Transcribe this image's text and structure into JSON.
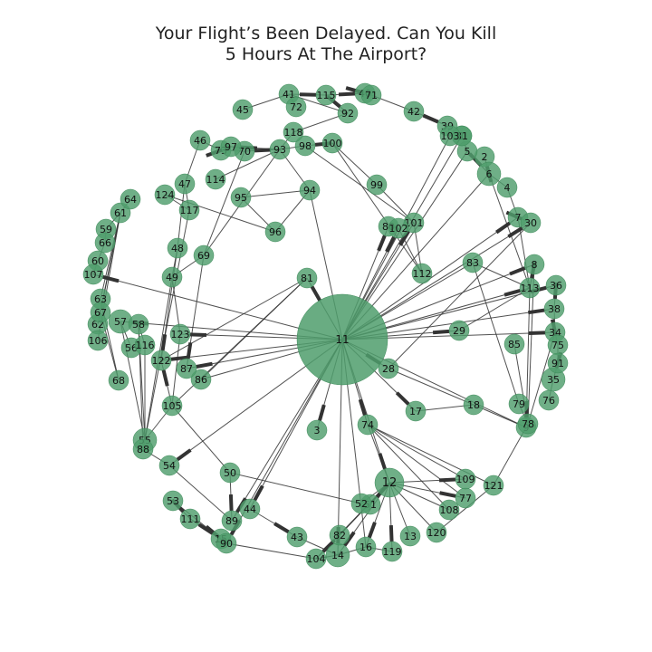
{
  "title": {
    "line1": "Your Flight’s Been Delayed. Can You Kill",
    "line2": "5 Hours At The Airport?"
  },
  "colors": {
    "node_fill": "#4f9d6c",
    "node_stroke": "#3c8a58",
    "edge": "#333333",
    "label": "#111111"
  },
  "nodes": [
    {
      "id": "11",
      "size": "xl"
    },
    {
      "id": "1",
      "size": "m"
    },
    {
      "id": "2",
      "size": "m"
    },
    {
      "id": "3",
      "size": "m"
    },
    {
      "id": "4",
      "size": "m"
    },
    {
      "id": "5",
      "size": "m"
    },
    {
      "id": "6",
      "size": "l"
    },
    {
      "id": "7",
      "size": "m"
    },
    {
      "id": "8",
      "size": "m"
    },
    {
      "id": "9",
      "size": "m"
    },
    {
      "id": "12",
      "size": "xl2"
    },
    {
      "id": "13",
      "size": "m"
    },
    {
      "id": "14",
      "size": "l"
    },
    {
      "id": "15",
      "size": "m"
    },
    {
      "id": "16",
      "size": "m"
    },
    {
      "id": "17",
      "size": "m"
    },
    {
      "id": "18",
      "size": "m"
    },
    {
      "id": "28",
      "size": "m"
    },
    {
      "id": "29",
      "size": "m"
    },
    {
      "id": "30",
      "size": "m"
    },
    {
      "id": "31",
      "size": "m"
    },
    {
      "id": "34",
      "size": "m"
    },
    {
      "id": "35",
      "size": "l"
    },
    {
      "id": "36",
      "size": "m"
    },
    {
      "id": "38",
      "size": "m"
    },
    {
      "id": "39",
      "size": "m"
    },
    {
      "id": "40",
      "size": "m"
    },
    {
      "id": "41",
      "size": "m"
    },
    {
      "id": "42",
      "size": "m"
    },
    {
      "id": "43",
      "size": "m"
    },
    {
      "id": "44",
      "size": "m"
    },
    {
      "id": "45",
      "size": "m"
    },
    {
      "id": "46",
      "size": "m"
    },
    {
      "id": "47",
      "size": "m"
    },
    {
      "id": "48",
      "size": "m"
    },
    {
      "id": "49",
      "size": "m"
    },
    {
      "id": "50",
      "size": "m"
    },
    {
      "id": "51",
      "size": "m"
    },
    {
      "id": "52",
      "size": "m"
    },
    {
      "id": "53",
      "size": "m"
    },
    {
      "id": "54",
      "size": "m"
    },
    {
      "id": "55",
      "size": "l"
    },
    {
      "id": "56",
      "size": "m"
    },
    {
      "id": "57",
      "size": "l"
    },
    {
      "id": "58",
      "size": "m"
    },
    {
      "id": "59",
      "size": "m"
    },
    {
      "id": "60",
      "size": "m"
    },
    {
      "id": "61",
      "size": "m"
    },
    {
      "id": "62",
      "size": "m"
    },
    {
      "id": "63",
      "size": "m"
    },
    {
      "id": "64",
      "size": "m"
    },
    {
      "id": "66",
      "size": "m"
    },
    {
      "id": "67",
      "size": "m"
    },
    {
      "id": "68",
      "size": "m"
    },
    {
      "id": "69",
      "size": "m"
    },
    {
      "id": "70",
      "size": "m"
    },
    {
      "id": "71",
      "size": "m"
    },
    {
      "id": "72",
      "size": "m"
    },
    {
      "id": "73",
      "size": "m"
    },
    {
      "id": "74",
      "size": "m"
    },
    {
      "id": "75",
      "size": "m"
    },
    {
      "id": "76",
      "size": "m"
    },
    {
      "id": "77",
      "size": "m"
    },
    {
      "id": "78",
      "size": "m"
    },
    {
      "id": "79",
      "size": "m"
    },
    {
      "id": "80",
      "size": "m"
    },
    {
      "id": "81",
      "size": "m"
    },
    {
      "id": "82",
      "size": "m"
    },
    {
      "id": "83",
      "size": "m"
    },
    {
      "id": "85",
      "size": "m"
    },
    {
      "id": "86",
      "size": "m"
    },
    {
      "id": "87",
      "size": "m"
    },
    {
      "id": "88",
      "size": "m"
    },
    {
      "id": "89",
      "size": "m"
    },
    {
      "id": "90",
      "size": "m"
    },
    {
      "id": "91",
      "size": "m"
    },
    {
      "id": "92",
      "size": "m"
    },
    {
      "id": "93",
      "size": "m"
    },
    {
      "id": "94",
      "size": "m"
    },
    {
      "id": "95",
      "size": "m"
    },
    {
      "id": "96",
      "size": "m"
    },
    {
      "id": "97",
      "size": "m"
    },
    {
      "id": "98",
      "size": "m"
    },
    {
      "id": "99",
      "size": "m"
    },
    {
      "id": "100",
      "size": "m"
    },
    {
      "id": "101",
      "size": "m"
    },
    {
      "id": "102",
      "size": "m"
    },
    {
      "id": "103",
      "size": "m"
    },
    {
      "id": "104",
      "size": "m"
    },
    {
      "id": "105",
      "size": "m"
    },
    {
      "id": "106",
      "size": "m"
    },
    {
      "id": "107",
      "size": "m"
    },
    {
      "id": "108",
      "size": "m"
    },
    {
      "id": "109",
      "size": "m"
    },
    {
      "id": "111",
      "size": "m"
    },
    {
      "id": "112",
      "size": "m"
    },
    {
      "id": "113",
      "size": "m"
    },
    {
      "id": "114",
      "size": "m"
    },
    {
      "id": "115",
      "size": "m"
    },
    {
      "id": "116",
      "size": "m"
    },
    {
      "id": "117",
      "size": "m"
    },
    {
      "id": "118",
      "size": "m"
    },
    {
      "id": "119",
      "size": "m"
    },
    {
      "id": "120",
      "size": "m"
    },
    {
      "id": "121",
      "size": "m"
    },
    {
      "id": "122",
      "size": "m"
    },
    {
      "id": "123",
      "size": "m"
    },
    {
      "id": "124",
      "size": "m"
    }
  ],
  "edges": [
    [
      "11",
      "81"
    ],
    [
      "11",
      "101"
    ],
    [
      "11",
      "102"
    ],
    [
      "11",
      "80"
    ],
    [
      "11",
      "7"
    ],
    [
      "11",
      "30"
    ],
    [
      "11",
      "8"
    ],
    [
      "11",
      "113"
    ],
    [
      "11",
      "36"
    ],
    [
      "11",
      "38"
    ],
    [
      "11",
      "34"
    ],
    [
      "11",
      "29"
    ],
    [
      "11",
      "28"
    ],
    [
      "11",
      "17"
    ],
    [
      "11",
      "74"
    ],
    [
      "11",
      "12"
    ],
    [
      "11",
      "3"
    ],
    [
      "11",
      "44"
    ],
    [
      "11",
      "89"
    ],
    [
      "11",
      "90"
    ],
    [
      "11",
      "14"
    ],
    [
      "11",
      "54"
    ],
    [
      "11",
      "87"
    ],
    [
      "11",
      "122"
    ],
    [
      "11",
      "123"
    ],
    [
      "11",
      "57"
    ],
    [
      "11",
      "107"
    ],
    [
      "11",
      "94"
    ],
    [
      "11",
      "5"
    ],
    [
      "11",
      "6"
    ],
    [
      "11",
      "1"
    ],
    [
      "11",
      "103"
    ],
    [
      "11",
      "83"
    ],
    [
      "11",
      "86"
    ],
    [
      "11",
      "9"
    ],
    [
      "11",
      "16"
    ],
    [
      "12",
      "74"
    ],
    [
      "12",
      "109"
    ],
    [
      "12",
      "77"
    ],
    [
      "12",
      "108"
    ],
    [
      "12",
      "120"
    ],
    [
      "12",
      "13"
    ],
    [
      "12",
      "119"
    ],
    [
      "12",
      "16"
    ],
    [
      "12",
      "14"
    ],
    [
      "12",
      "51"
    ],
    [
      "12",
      "52"
    ],
    [
      "12",
      "82"
    ],
    [
      "12",
      "104"
    ],
    [
      "74",
      "109"
    ],
    [
      "74",
      "77"
    ],
    [
      "74",
      "108"
    ],
    [
      "74",
      "121"
    ],
    [
      "93",
      "70"
    ],
    [
      "93",
      "97"
    ],
    [
      "93",
      "118"
    ],
    [
      "93",
      "98"
    ],
    [
      "93",
      "69"
    ],
    [
      "93",
      "94"
    ],
    [
      "93",
      "114"
    ],
    [
      "100",
      "98"
    ],
    [
      "100",
      "99"
    ],
    [
      "100",
      "112"
    ],
    [
      "98",
      "101"
    ],
    [
      "41",
      "115"
    ],
    [
      "41",
      "45"
    ],
    [
      "115",
      "40"
    ],
    [
      "115",
      "92"
    ],
    [
      "40",
      "71"
    ],
    [
      "71",
      "42"
    ],
    [
      "42",
      "39"
    ],
    [
      "39",
      "103"
    ],
    [
      "103",
      "1"
    ],
    [
      "1",
      "5"
    ],
    [
      "5",
      "6"
    ],
    [
      "6",
      "2"
    ],
    [
      "6",
      "4"
    ],
    [
      "6",
      "113"
    ],
    [
      "4",
      "7"
    ],
    [
      "7",
      "30"
    ],
    [
      "7",
      "113"
    ],
    [
      "8",
      "113"
    ],
    [
      "8",
      "78"
    ],
    [
      "113",
      "9"
    ],
    [
      "36",
      "38"
    ],
    [
      "38",
      "34"
    ],
    [
      "34",
      "75"
    ],
    [
      "75",
      "91"
    ],
    [
      "91",
      "35"
    ],
    [
      "35",
      "76"
    ],
    [
      "34",
      "78"
    ],
    [
      "85",
      "78"
    ],
    [
      "83",
      "79"
    ],
    [
      "79",
      "78"
    ],
    [
      "18",
      "9"
    ],
    [
      "18",
      "17"
    ],
    [
      "18",
      "28"
    ],
    [
      "9",
      "121"
    ],
    [
      "121",
      "120"
    ],
    [
      "95",
      "94"
    ],
    [
      "95",
      "96"
    ],
    [
      "96",
      "94"
    ],
    [
      "124",
      "117"
    ],
    [
      "124",
      "96"
    ],
    [
      "117",
      "47"
    ],
    [
      "47",
      "46"
    ],
    [
      "47",
      "48"
    ],
    [
      "46",
      "73"
    ],
    [
      "73",
      "70"
    ],
    [
      "73",
      "97"
    ],
    [
      "48",
      "49"
    ],
    [
      "49",
      "55"
    ],
    [
      "48",
      "122"
    ],
    [
      "69",
      "87"
    ],
    [
      "69",
      "70"
    ],
    [
      "69",
      "49"
    ],
    [
      "64",
      "61"
    ],
    [
      "61",
      "59"
    ],
    [
      "59",
      "66"
    ],
    [
      "66",
      "60"
    ],
    [
      "60",
      "107"
    ],
    [
      "61",
      "63"
    ],
    [
      "61",
      "67"
    ],
    [
      "61",
      "62"
    ],
    [
      "61",
      "106"
    ],
    [
      "63",
      "68"
    ],
    [
      "67",
      "68"
    ],
    [
      "57",
      "56"
    ],
    [
      "57",
      "55"
    ],
    [
      "58",
      "116"
    ],
    [
      "58",
      "88"
    ],
    [
      "58",
      "55"
    ],
    [
      "116",
      "55"
    ],
    [
      "117",
      "55"
    ],
    [
      "123",
      "105"
    ],
    [
      "123",
      "49"
    ],
    [
      "105",
      "122"
    ],
    [
      "105",
      "55"
    ],
    [
      "105",
      "50"
    ],
    [
      "50",
      "89"
    ],
    [
      "50",
      "52"
    ],
    [
      "55",
      "88"
    ],
    [
      "88",
      "54"
    ],
    [
      "54",
      "89"
    ],
    [
      "53",
      "111"
    ],
    [
      "53",
      "15"
    ],
    [
      "111",
      "90"
    ],
    [
      "111",
      "15"
    ],
    [
      "15",
      "90"
    ],
    [
      "90",
      "104"
    ],
    [
      "44",
      "43"
    ],
    [
      "43",
      "14"
    ],
    [
      "14",
      "16"
    ],
    [
      "16",
      "119"
    ],
    [
      "14",
      "104"
    ],
    [
      "82",
      "104"
    ],
    [
      "82",
      "12"
    ],
    [
      "92",
      "41"
    ],
    [
      "92",
      "118"
    ],
    [
      "81",
      "105"
    ],
    [
      "81",
      "86"
    ],
    [
      "81",
      "122"
    ],
    [
      "99",
      "101"
    ],
    [
      "101",
      "112"
    ],
    [
      "102",
      "112"
    ],
    [
      "80",
      "102"
    ],
    [
      "83",
      "113"
    ],
    [
      "28",
      "30"
    ],
    [
      "29",
      "113"
    ],
    [
      "72",
      "41"
    ]
  ],
  "thick_edges": [
    [
      "11",
      "81"
    ],
    [
      "11",
      "101"
    ],
    [
      "11",
      "102"
    ],
    [
      "11",
      "80"
    ],
    [
      "11",
      "7"
    ],
    [
      "11",
      "30"
    ],
    [
      "11",
      "8"
    ],
    [
      "11",
      "113"
    ],
    [
      "11",
      "36"
    ],
    [
      "11",
      "38"
    ],
    [
      "11",
      "34"
    ],
    [
      "11",
      "29"
    ],
    [
      "11",
      "28"
    ],
    [
      "11",
      "17"
    ],
    [
      "11",
      "74"
    ],
    [
      "11",
      "12"
    ],
    [
      "11",
      "3"
    ],
    [
      "11",
      "44"
    ],
    [
      "11",
      "89"
    ],
    [
      "11",
      "90"
    ],
    [
      "11",
      "14"
    ],
    [
      "11",
      "54"
    ],
    [
      "11",
      "87"
    ],
    [
      "11",
      "122"
    ],
    [
      "11",
      "123"
    ],
    [
      "11",
      "57"
    ],
    [
      "11",
      "107"
    ],
    [
      "12",
      "51"
    ],
    [
      "12",
      "109"
    ],
    [
      "12",
      "77"
    ],
    [
      "12",
      "14"
    ],
    [
      "12",
      "16"
    ],
    [
      "12",
      "119"
    ],
    [
      "69",
      "87"
    ],
    [
      "48",
      "122"
    ],
    [
      "105",
      "122"
    ],
    [
      "117",
      "124"
    ],
    [
      "93",
      "70"
    ],
    [
      "93",
      "97"
    ],
    [
      "73",
      "97"
    ],
    [
      "100",
      "98"
    ],
    [
      "41",
      "115"
    ],
    [
      "115",
      "40"
    ],
    [
      "115",
      "92"
    ],
    [
      "40",
      "71"
    ],
    [
      "42",
      "39"
    ],
    [
      "5",
      "6"
    ],
    [
      "6",
      "2"
    ],
    [
      "7",
      "30"
    ],
    [
      "8",
      "113"
    ],
    [
      "113",
      "9"
    ],
    [
      "36",
      "38"
    ],
    [
      "34",
      "75"
    ],
    [
      "91",
      "35"
    ],
    [
      "74",
      "12"
    ],
    [
      "82",
      "104"
    ],
    [
      "111",
      "15"
    ],
    [
      "15",
      "90"
    ],
    [
      "44",
      "43"
    ],
    [
      "50",
      "89"
    ],
    [
      "53",
      "111"
    ]
  ]
}
